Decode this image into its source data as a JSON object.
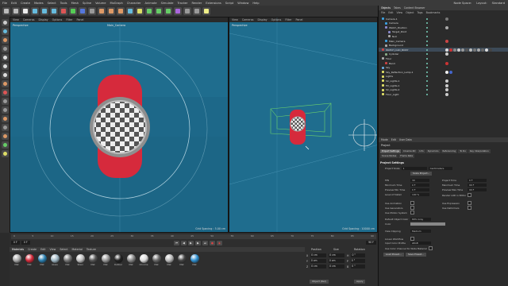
{
  "menubar": {
    "items": [
      "File",
      "Edit",
      "Create",
      "Modes",
      "Select",
      "Tools",
      "Mesh",
      "Spline",
      "Volume",
      "MoGraph",
      "Character",
      "Animate",
      "Simulate",
      "Tracker",
      "Render",
      "Extensions",
      "Script",
      "Window",
      "Help"
    ],
    "node_space": "Node Space:",
    "layout": "Layout:",
    "layout_value": "Standard"
  },
  "viewport_left": {
    "menu": [
      "View",
      "Cameras",
      "Display",
      "Options",
      "Filter",
      "Panel"
    ],
    "label": "Perspective",
    "camera": "Main_Camera",
    "grid": "Grid Spacing : 5.00 cm"
  },
  "viewport_right": {
    "menu": [
      "View",
      "Cameras",
      "Display",
      "Options",
      "Filter",
      "Panel"
    ],
    "label": "Perspective",
    "grid": "Grid Spacing : 10000 cm"
  },
  "timeline": {
    "ticks": [
      "0",
      "5",
      "10",
      "15",
      "20",
      "25",
      "30",
      "35",
      "40",
      "45",
      "50",
      "55",
      "60",
      "65",
      "70",
      "75",
      "80",
      "85",
      "90"
    ],
    "start": "0 F",
    "current": "0 F",
    "end": "90 F"
  },
  "materials": {
    "menu": [
      "Create",
      "Edit",
      "View",
      "Select",
      "Material",
      "Texture"
    ],
    "tab": "Materials",
    "items": [
      {
        "name": "Mat",
        "color": "#aaaaaa"
      },
      {
        "name": "Mat",
        "color": "#d42a3a"
      },
      {
        "name": "Mat",
        "color": "#2a7fb0"
      },
      {
        "name": "Glass",
        "color": "#9fb7c4"
      },
      {
        "name": "Mat",
        "color": "#777777"
      },
      {
        "name": "Steel",
        "color": "#c0c0c0"
      },
      {
        "name": "Mat",
        "color": "#555555"
      },
      {
        "name": "Mat",
        "color": "#999999"
      },
      {
        "name": "Rubber",
        "color": "#222222"
      },
      {
        "name": "Mat",
        "color": "#888888"
      },
      {
        "name": "Chrome",
        "color": "#dddddd"
      },
      {
        "name": "Mat",
        "color": "#666666"
      },
      {
        "name": "Mat",
        "color": "#bbbbbb"
      },
      {
        "name": "Mat",
        "color": "#444444"
      },
      {
        "name": "Mat",
        "color": "#2f8fd0"
      }
    ]
  },
  "coords": {
    "position": "Position",
    "size": "Size",
    "rotation": "Rotation",
    "rows": [
      {
        "axis": "X",
        "pos": "0 cm",
        "size": "0 cm",
        "rot_label": "H",
        "rot": "0 °"
      },
      {
        "axis": "Y",
        "pos": "0 cm",
        "size": "0 cm",
        "rot_label": "P",
        "rot": "0 °"
      },
      {
        "axis": "Z",
        "pos": "0 cm",
        "size": "0 cm",
        "rot_label": "B",
        "rot": "0 °"
      }
    ],
    "mode": "Object (Rel)",
    "apply": "Apply"
  },
  "objmgr": {
    "tabs": [
      "Objects",
      "Takes",
      "Content Browser"
    ],
    "menu": [
      "File",
      "Edit",
      "View",
      "Object",
      "Tags",
      "Bookmarks"
    ],
    "rows": [
      {
        "name": "Camera.1",
        "color": "#3aa0e0",
        "indent": 0,
        "tags": [
          "#777"
        ]
      },
      {
        "name": "Camera",
        "color": "#3aa0e0",
        "indent": 4,
        "tags": []
      },
      {
        "name": "Watch_Position",
        "color": "#88c",
        "indent": 4,
        "tags": [
          "#aaa"
        ]
      },
      {
        "name": "Target_Point",
        "color": "#88c",
        "indent": 8,
        "tags": []
      },
      {
        "name": "Null",
        "color": "#aaa",
        "indent": 8,
        "tags": []
      },
      {
        "name": "Main_Camera",
        "color": "#3aa0e0",
        "indent": 4,
        "tags": [
          "#c44"
        ]
      },
      {
        "name": "Background",
        "color": "#aaa",
        "indent": 4,
        "tags": []
      },
      {
        "name": "WATCH_CAD_BODY",
        "color": "#c44",
        "indent": 0,
        "tags": [
          "#ddd",
          "#c33",
          "#888",
          "#ccc",
          "#999",
          "#555",
          "#bbb",
          "#777",
          "#aaa",
          "#666",
          "#ddd",
          "#444"
        ]
      },
      {
        "name": "Cylinder",
        "color": "#8a8",
        "indent": 4,
        "tags": [
          "#ccc"
        ]
      },
      {
        "name": "Floor",
        "color": "#aaa",
        "indent": 0,
        "tags": []
      },
      {
        "name": "Band",
        "color": "#c44",
        "indent": 4,
        "tags": [
          "#c33"
        ]
      },
      {
        "name": "Sky",
        "color": "#6ad",
        "indent": 0,
        "tags": []
      },
      {
        "name": "Sky_Reflection_Lamp.1",
        "color": "#dd6",
        "indent": 0,
        "tags": [
          "#eee",
          "#46c"
        ]
      },
      {
        "name": "Lights",
        "color": "#dd6",
        "indent": 0,
        "tags": []
      },
      {
        "name": "SC_Lights.1",
        "color": "#dd6",
        "indent": 0,
        "tags": [
          "#ccc"
        ]
      },
      {
        "name": "Fill_Lights.1",
        "color": "#dd6",
        "indent": 0,
        "tags": [
          "#ccc"
        ]
      },
      {
        "name": "SC_Lights.2",
        "color": "#dd6",
        "indent": 0,
        "tags": [
          "#ccc"
        ]
      },
      {
        "name": "Floor_Light",
        "color": "#dd6",
        "indent": 0,
        "tags": [
          "#ccc"
        ]
      }
    ]
  },
  "attr": {
    "menu": [
      "Mode",
      "Edit",
      "User Data"
    ],
    "title": "Project",
    "tabs": [
      "Project Settings",
      "Cinema 4D",
      "Info",
      "Dynamics",
      "Referencing",
      "To Do",
      "Key Interpolation",
      "Scene Nodes",
      "Frame Rate"
    ],
    "section": "Project Settings",
    "scale_label": "Project Scale",
    "scale_value": "1",
    "scale_unit": "Centimeters",
    "scale_btn": "Scale Project...",
    "fields": [
      [
        "FPS",
        "30",
        "Project Time",
        "0 F"
      ],
      [
        "Minimum Time",
        "0 F",
        "Maximum Time",
        "90 F"
      ],
      [
        "Preview Min Time",
        "0 F",
        "Preview Max Time",
        "90 F"
      ],
      [
        "Level of Detail",
        "100 %",
        "Render LOD in Editor",
        ""
      ]
    ],
    "checks": [
      [
        "Use Animation",
        "Use Expression"
      ],
      [
        "Use Generators",
        "Use Deformers"
      ],
      [
        "Use Motion System",
        ""
      ]
    ],
    "default_color_label": "Default Object Color",
    "default_color": "80% Gray",
    "color_label": "Color",
    "clip_label": "View Clipping",
    "clip_value": "Medium",
    "linear_label": "Linear Workflow",
    "input_label": "Input Color Profile",
    "input_value": "sRGB",
    "vertex_label": "Use Color Channel for Node Material",
    "load_btn": "Load Preset...",
    "save_btn": "Save Preset..."
  }
}
